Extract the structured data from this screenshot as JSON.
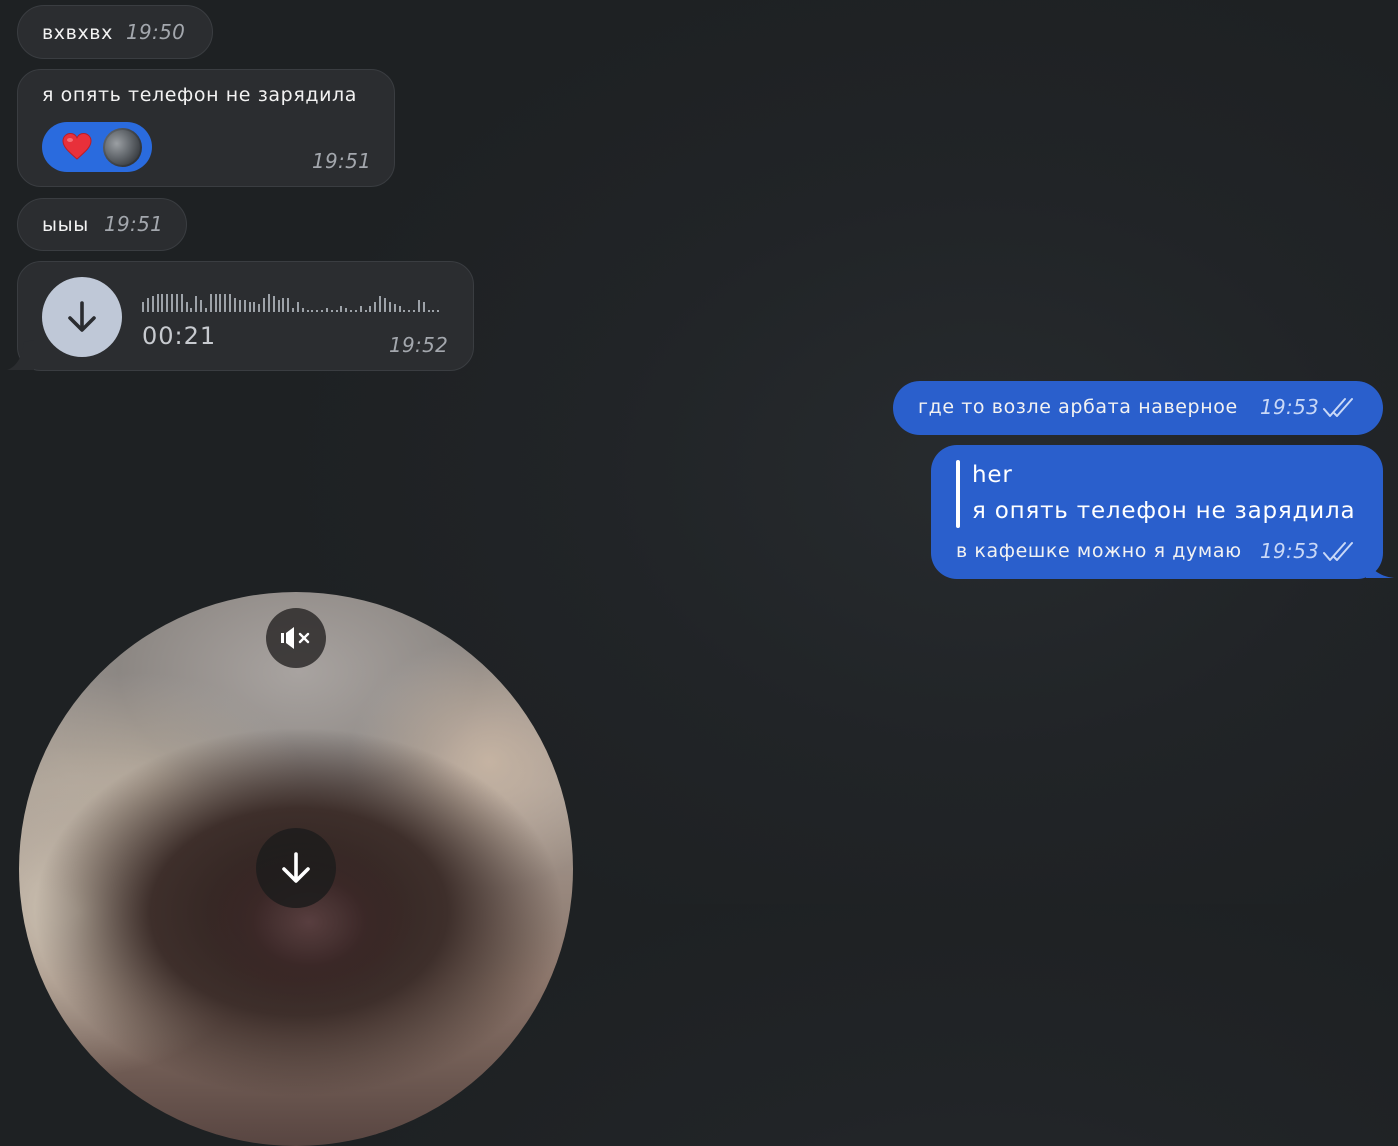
{
  "colors": {
    "incoming_bubble": "#2b2d30",
    "outgoing_bubble": "#2a5fcc",
    "reaction_pill": "#2a6bde",
    "voice_button": "#bfc8d7",
    "background": "#212427"
  },
  "messages": {
    "m1": {
      "text": "вхвхвх",
      "time": "19:50"
    },
    "m2": {
      "text": "я опять телефон не зарядила",
      "time": "19:51",
      "reactions": [
        {
          "icon": "heart-icon"
        },
        {
          "icon": "avatar"
        }
      ]
    },
    "m3": {
      "text": "ыыы",
      "time": "19:51"
    },
    "m4": {
      "type": "voice",
      "duration": "00:21",
      "time": "19:52",
      "waveform": [
        10,
        14,
        16,
        18,
        18,
        18,
        18,
        18,
        18,
        10,
        4,
        16,
        12,
        4,
        18,
        18,
        18,
        18,
        18,
        14,
        12,
        12,
        10,
        10,
        8,
        14,
        18,
        16,
        12,
        14,
        14,
        4,
        10,
        4,
        2,
        2,
        2,
        2,
        4,
        2,
        2,
        6,
        4,
        2,
        2,
        6,
        2,
        6,
        10,
        16,
        14,
        10,
        8,
        6,
        2,
        2,
        2,
        12,
        10,
        2,
        2,
        2
      ],
      "icon": "download-icon"
    },
    "m5": {
      "text": "где то возле арбата наверное",
      "time": "19:53",
      "status": "double-check-icon"
    },
    "m6": {
      "reply": {
        "author": "her",
        "text": "я опять телефон не зарядила"
      },
      "text": "в кафешке можно я думаю",
      "time": "19:53",
      "status": "double-check-icon"
    },
    "m7": {
      "type": "video",
      "mute_icon": "mute-icon",
      "download_icon": "download-icon"
    }
  }
}
